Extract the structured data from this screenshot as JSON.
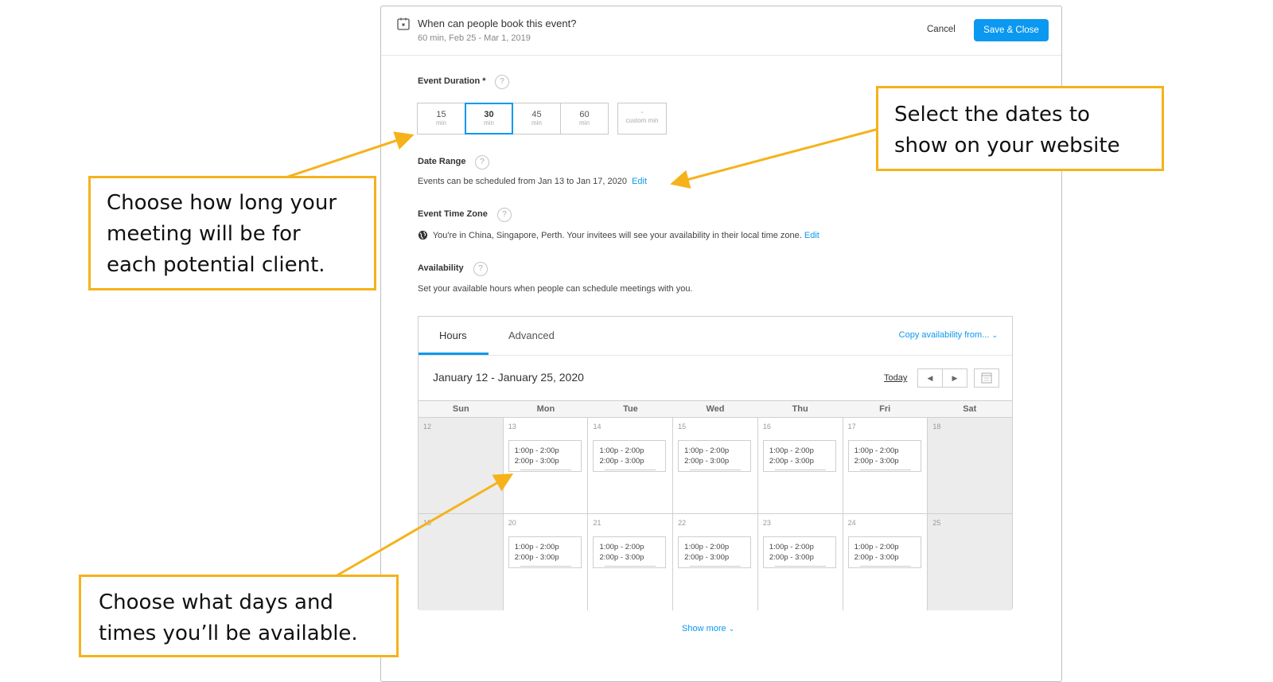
{
  "header": {
    "title": "When can people book this event?",
    "subtitle": "60 min, Feb 25 - Mar 1, 2019",
    "cancel_label": "Cancel",
    "save_label": "Save & Close"
  },
  "duration": {
    "label": "Event Duration *",
    "options": [
      {
        "value": "15",
        "unit": "min"
      },
      {
        "value": "30",
        "unit": "min"
      },
      {
        "value": "45",
        "unit": "min"
      },
      {
        "value": "60",
        "unit": "min"
      }
    ],
    "selected": "30",
    "custom": {
      "value": "-",
      "unit": "custom min"
    }
  },
  "date_range": {
    "label": "Date Range",
    "text": "Events can be scheduled from Jan 13 to Jan 17, 2020",
    "edit": "Edit"
  },
  "time_zone": {
    "label": "Event Time Zone",
    "text": "You're in China, Singapore, Perth. Your invitees will see your availability in their local time zone.",
    "edit": "Edit"
  },
  "availability": {
    "label": "Availability",
    "text": "Set your available hours when people can schedule meetings with you."
  },
  "calendar": {
    "tabs": [
      "Hours",
      "Advanced"
    ],
    "copy_label": "Copy availability from...",
    "range_title": "January 12 - January 25, 2020",
    "today": "Today",
    "weekdays": [
      "Sun",
      "Mon",
      "Tue",
      "Wed",
      "Thu",
      "Fri",
      "Sat"
    ],
    "weeks": [
      [
        "12",
        "13",
        "14",
        "15",
        "16",
        "17",
        "18"
      ],
      [
        "19",
        "20",
        "21",
        "22",
        "23",
        "24",
        "25"
      ]
    ],
    "slots": [
      "1:00p - 2:00p",
      "2:00p - 3:00p"
    ],
    "show_more": "Show more"
  },
  "callouts": {
    "duration": [
      "Choose how long your",
      "meeting will be for",
      "each potential client."
    ],
    "dates": [
      "Select the dates to",
      "show on your website"
    ],
    "availability": [
      "Choose what days and",
      "times you’ll be available."
    ]
  },
  "colors": {
    "accent": "#0a98f0",
    "callout": "#f6b21b"
  }
}
